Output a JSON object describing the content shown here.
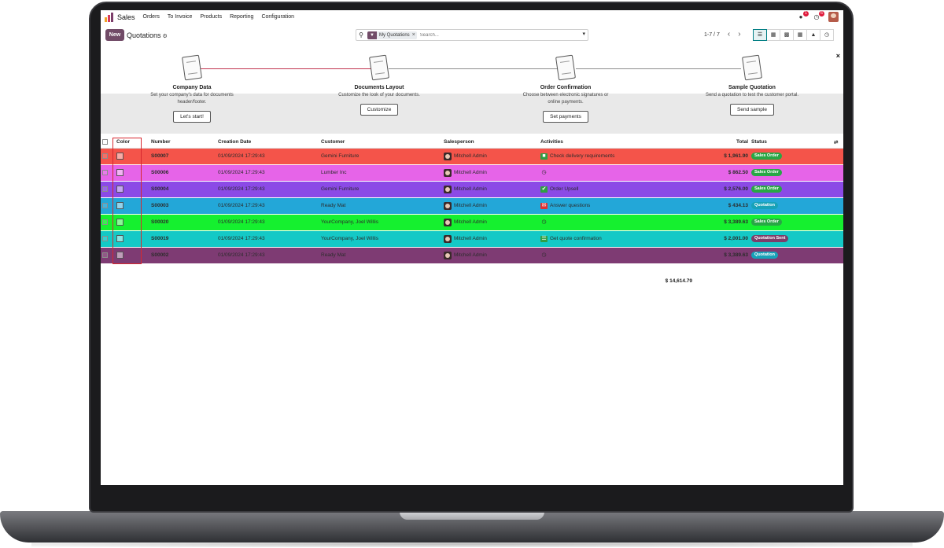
{
  "nav": {
    "app": "Sales",
    "menus": [
      "Orders",
      "To Invoice",
      "Products",
      "Reporting",
      "Configuration"
    ],
    "chat_count": "1",
    "activity_count": "6"
  },
  "control": {
    "new_label": "New",
    "breadcrumb": "Quotations",
    "facet": "My Quotations",
    "search_placeholder": "Search...",
    "pager": "1-7 / 7"
  },
  "onboarding": {
    "steps": [
      {
        "title": "Company Data",
        "desc": "Set your company's data for documents header/footer.",
        "button": "Let's start!"
      },
      {
        "title": "Documents Layout",
        "desc": "Customize the look of your documents.",
        "button": "Customize"
      },
      {
        "title": "Order Confirmation",
        "desc": "Choose between electronic signatures or online payments.",
        "button": "Set payments"
      },
      {
        "title": "Sample Quotation",
        "desc": "Send a quotation to test the customer portal.",
        "button": "Send sample"
      }
    ]
  },
  "table": {
    "headers": {
      "color": "Color",
      "number": "Number",
      "date": "Creation Date",
      "customer": "Customer",
      "salesperson": "Salesperson",
      "activities": "Activities",
      "total": "Total",
      "status": "Status"
    },
    "rows": [
      {
        "bg": "#f4544a",
        "number": "S00007",
        "date": "01/09/2024 17:29:43",
        "customer": "Gemini Furniture",
        "salesperson": "Mitchell Admin",
        "activity": "Check delivery requirements",
        "act_icon": "truck-icon",
        "act_color": "#2f9e44",
        "total": "$ 1,961.90",
        "status": "Sales Order",
        "status_color": "#28a745"
      },
      {
        "bg": "#e664e8",
        "number": "S00006",
        "date": "01/09/2024 17:29:43",
        "customer": "Lumber Inc",
        "salesperson": "Mitchell Admin",
        "activity": "",
        "act_icon": "clock-icon",
        "act_color": "",
        "total": "$ 862.50",
        "status": "Sales Order",
        "status_color": "#28a745"
      },
      {
        "bg": "#8b4ae6",
        "number": "S00004",
        "date": "01/09/2024 17:29:43",
        "customer": "Gemini Furniture",
        "salesperson": "Mitchell Admin",
        "activity": "Order Upsell",
        "act_icon": "check-icon",
        "act_color": "#2f9e44",
        "total": "$ 2,576.00",
        "status": "Sales Order",
        "status_color": "#28a745"
      },
      {
        "bg": "#23a7d8",
        "number": "S00003",
        "date": "01/09/2024 17:29:43",
        "customer": "Ready Mat",
        "salesperson": "Mitchell Admin",
        "activity": "Answer questions",
        "act_icon": "envelope-icon",
        "act_color": "#e03131",
        "total": "$ 434.13",
        "status": "Quotation",
        "status_color": "#17a2b8"
      },
      {
        "bg": "#15f02f",
        "number": "S00020",
        "date": "01/09/2024 17:29:43",
        "customer": "YourCompany, Joel Willis",
        "salesperson": "Mitchell Admin",
        "activity": "",
        "act_icon": "clock-icon",
        "act_color": "",
        "total": "$ 3,389.63",
        "status": "Sales Order",
        "status_color": "#28a745"
      },
      {
        "bg": "#14c9c6",
        "number": "S00019",
        "date": "01/09/2024 17:29:43",
        "customer": "YourCompany, Joel Willis",
        "salesperson": "Mitchell Admin",
        "activity": "Get quote confirmation",
        "act_icon": "list-icon",
        "act_color": "#2f9e44",
        "total": "$ 2,001.00",
        "status": "Quotation Sent",
        "status_color": "#7b3e6a"
      },
      {
        "bg": "#7e3b73",
        "number": "S00002",
        "date": "01/09/2024 17:29:43",
        "customer": "Ready Mat",
        "salesperson": "Mitchell Admin",
        "activity": "",
        "act_icon": "clock-icon",
        "act_color": "",
        "total": "$ 3,389.63",
        "status": "Quotation",
        "status_color": "#17a2b8"
      }
    ],
    "grand_total": "$ 14,614.79"
  }
}
